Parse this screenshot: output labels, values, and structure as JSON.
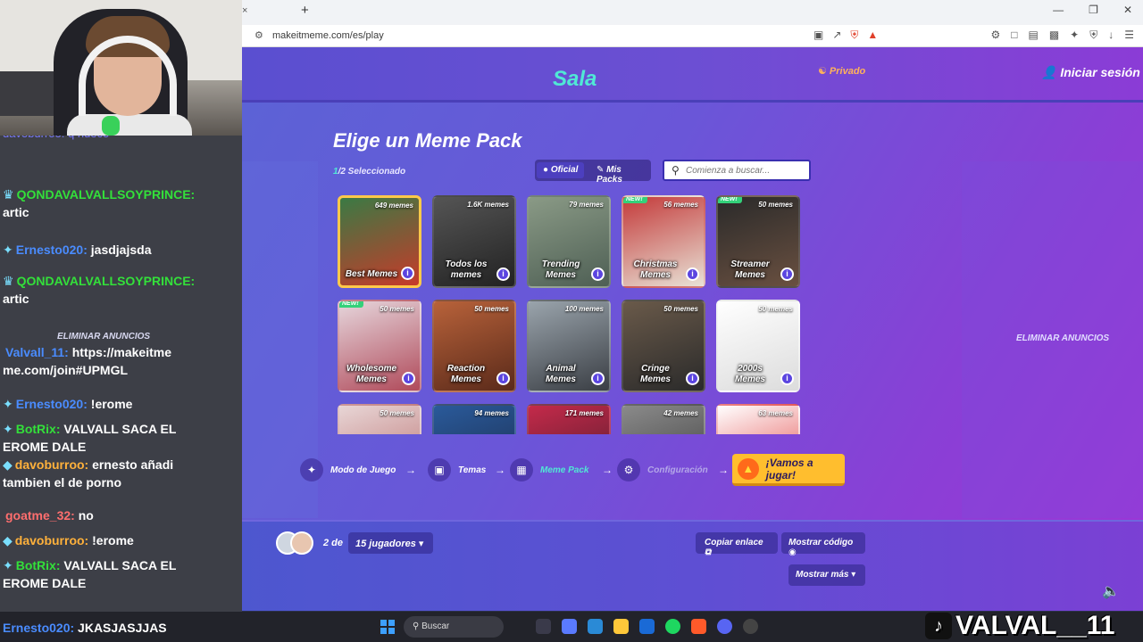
{
  "browser": {
    "url": "makeitmeme.com/es/play",
    "tab_close": "×",
    "new_tab": "+"
  },
  "chat": {
    "top_partial": "davoburroo: q hueco",
    "ads_label": "ELIMINAR ANUNCIOS",
    "messages": [
      {
        "user": "QONDAVALVALLSOYPRINCE:",
        "text": "artic",
        "user_color": "green",
        "badge": "crown"
      },
      {
        "user": "Ernesto020:",
        "text": "jasdjajsda",
        "user_color": "blue",
        "badge": "sparkle"
      },
      {
        "user": "QONDAVALVALLSOYPRINCE:",
        "text": "artic",
        "user_color": "green",
        "badge": "crown"
      },
      {
        "user": "Valvall_11:",
        "text": "https://makeitme me.com/join#UPMGL",
        "user_color": "blue",
        "badge": "none"
      },
      {
        "user": "Ernesto020:",
        "text": "!erome",
        "user_color": "blue",
        "badge": "sparkle"
      },
      {
        "user": "BotRix:",
        "text": "VALVALL SACA EL EROME DALE",
        "user_color": "green",
        "badge": "sparkle"
      },
      {
        "user": "davoburroo:",
        "text": "ernesto añadi tambien el de porno",
        "user_color": "orange",
        "badge": "diamond"
      },
      {
        "user": "goatme_32:",
        "text": "no",
        "user_color": "red",
        "badge": "none"
      },
      {
        "user": "davoburroo:",
        "text": "!erome",
        "user_color": "orange",
        "badge": "diamond"
      },
      {
        "user": "BotRix:",
        "text": "VALVALL SACA EL EROME DALE",
        "user_color": "green",
        "badge": "sparkle"
      }
    ],
    "last": {
      "user": "Ernesto020:",
      "text": "JKASJASJJAS"
    }
  },
  "header": {
    "title": "Sala",
    "private_label": "Privado",
    "login_label": "Iniciar sesión"
  },
  "packs": {
    "heading": "Elige un Meme Pack",
    "selected_num": "1",
    "selected_text": "/2 Seleccionado",
    "tab_official": "Oficial",
    "tab_mine": "Mis Packs",
    "search_placeholder": "Comienza a buscar...",
    "ads_label": "ELIMINAR ANUNCIOS",
    "cards": [
      {
        "name": "Best Memes",
        "count": "649 memes",
        "selected": true,
        "new": false,
        "colors": [
          "#3a7a44",
          "#c73a2a"
        ]
      },
      {
        "name": "Todos los memes",
        "count": "1.6K memes",
        "selected": false,
        "new": false,
        "colors": [
          "#555",
          "#222"
        ]
      },
      {
        "name": "Trending Memes",
        "count": "79 memes",
        "selected": false,
        "new": false,
        "colors": [
          "#8a9a86",
          "#4e5f54"
        ]
      },
      {
        "name": "Christmas Memes",
        "count": "56 memes",
        "selected": false,
        "new": true,
        "colors": [
          "#c43a3a",
          "#e8e2d6"
        ]
      },
      {
        "name": "Streamer Memes",
        "count": "50 memes",
        "selected": false,
        "new": true,
        "colors": [
          "#2a2a2a",
          "#6a5040"
        ]
      },
      {
        "name": "Wholesome Memes",
        "count": "50 memes",
        "selected": false,
        "new": true,
        "colors": [
          "#e6d6dc",
          "#b04a5a"
        ]
      },
      {
        "name": "Reaction Memes",
        "count": "50 memes",
        "selected": false,
        "new": false,
        "colors": [
          "#b8623a",
          "#5a2a1a"
        ]
      },
      {
        "name": "Animal Memes",
        "count": "100 memes",
        "selected": false,
        "new": false,
        "colors": [
          "#9aa4ac",
          "#3a3e44"
        ]
      },
      {
        "name": "Cringe Memes",
        "count": "50 memes",
        "selected": false,
        "new": false,
        "colors": [
          "#6a5a4a",
          "#2a2a2a"
        ]
      },
      {
        "name": "2000s Memes",
        "count": "50 memes",
        "selected": false,
        "new": false,
        "colors": [
          "#ffffff",
          "#dcdcdc"
        ]
      },
      {
        "name": "",
        "count": "50 memes",
        "selected": false,
        "new": false,
        "colors": [
          "#e8d6d6",
          "#b86a6a"
        ]
      },
      {
        "name": "",
        "count": "94 memes",
        "selected": false,
        "new": false,
        "colors": [
          "#2a5a9a",
          "#1a2a4a"
        ]
      },
      {
        "name": "",
        "count": "171 memes",
        "selected": false,
        "new": false,
        "colors": [
          "#c42a4a",
          "#4a1a2a"
        ]
      },
      {
        "name": "",
        "count": "42 memes",
        "selected": false,
        "new": false,
        "colors": [
          "#8a8a8a",
          "#3a3a3a"
        ]
      },
      {
        "name": "",
        "count": "63 memes",
        "selected": false,
        "new": false,
        "colors": [
          "#ffffff",
          "#e03a3a"
        ]
      }
    ]
  },
  "steps": {
    "items": [
      {
        "label": "Modo de Juego",
        "state": "done",
        "icon": "gear-star-icon"
      },
      {
        "label": "Temas",
        "state": "done",
        "icon": "chat-icon"
      },
      {
        "label": "Meme Pack",
        "state": "active",
        "icon": "image-icon"
      },
      {
        "label": "Configuración",
        "state": "disabled",
        "icon": "settings-icon"
      }
    ],
    "arrow": "→",
    "play_label": "¡Vamos a jugar!"
  },
  "footer": {
    "players_of": "2 de",
    "players_select": "15 jugadores",
    "copy_link": "Copiar enlace",
    "show_code": "Mostrar código",
    "show_more": "Mostrar más"
  },
  "taskbar": {
    "search_placeholder": "Buscar"
  },
  "overlay": {
    "tiktok_handle": "VALVAL__11"
  },
  "colors": {
    "accent_teal": "#50e8d5",
    "play_yellow": "#ffbe2e",
    "selected_border": "#ffc94a"
  }
}
